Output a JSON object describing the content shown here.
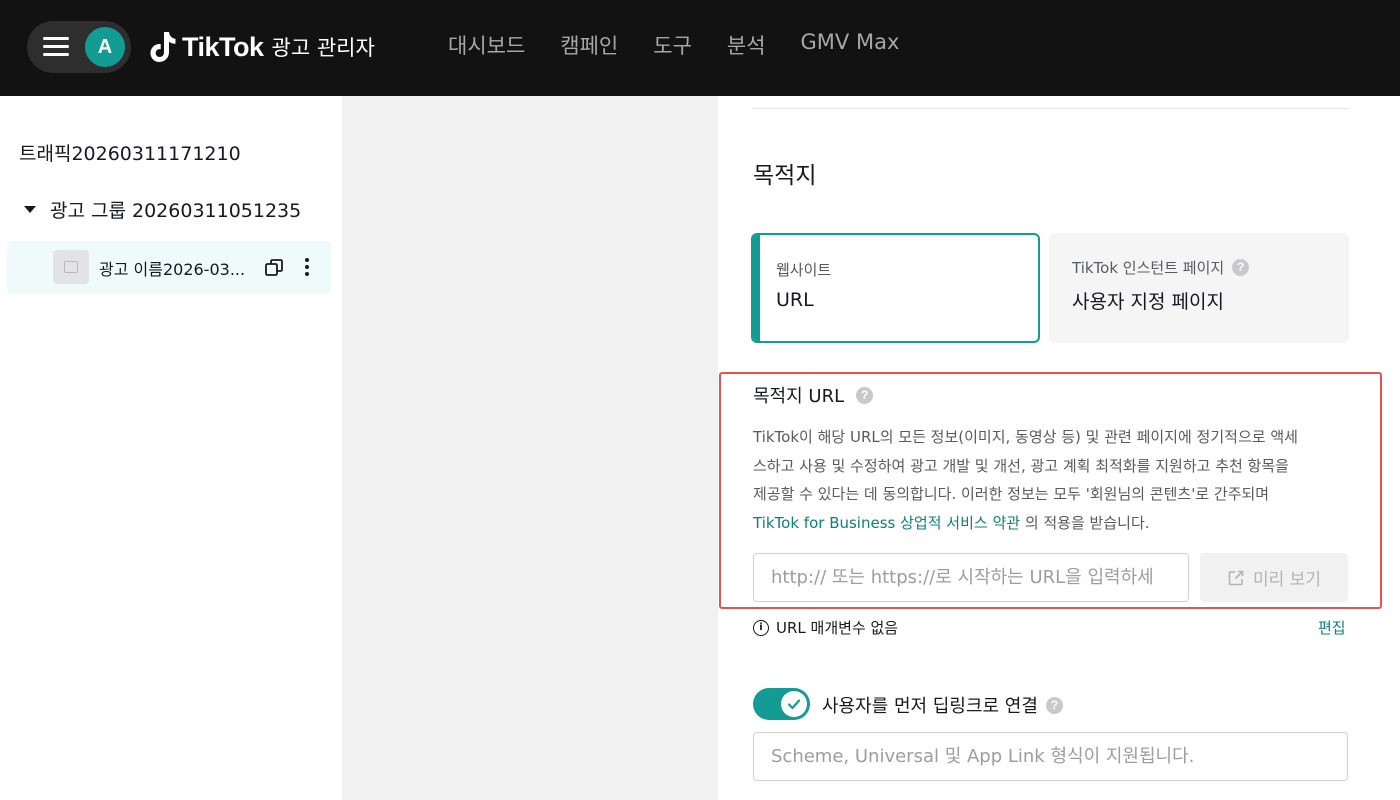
{
  "header": {
    "avatar_letter": "A",
    "brand": "TikTok",
    "brand_sub": "광고 관리자",
    "nav": [
      "대시보드",
      "캠페인",
      "도구",
      "분석",
      "GMV Max"
    ]
  },
  "sidebar": {
    "campaign_name": "트래픽20260311171210",
    "ad_group_name": "광고 그룹 20260311051235",
    "ad_name": "광고 이름2026-03..."
  },
  "destination": {
    "title": "목적지",
    "cards": [
      {
        "label": "웹사이트",
        "value": "URL",
        "selected": true
      },
      {
        "label": "TikTok 인스턴트 페이지",
        "value": "사용자 지정 페이지",
        "selected": false
      }
    ],
    "url_title": "목적지 URL",
    "description_lines": [
      "TikTok이 해당 URL의 모든 정보(이미지, 동영상 등) 및 관련 페이지에 정기적으로 액세",
      "스하고 사용 및 수정하여 광고 개발 및 개선, 광고 계획 최적화를 지원하고 추천 항목을",
      "제공할 수 있다는 데 동의합니다. 이러한 정보는 모두 '회원님의 콘텐츠'로 간주되며"
    ],
    "terms_link": "TikTok for Business 상업적 서비스 약관",
    "terms_suffix": " 의 적용을 받습니다.",
    "url_placeholder": "http:// 또는 https://로 시작하는 URL을 입력하세",
    "preview_label": "미리 보기",
    "params_text": "URL 매개변수 없음",
    "edit_label": "편집",
    "deeplink_label": "사용자를 먼저 딥링크로 연결",
    "deeplink_enabled": true,
    "deeplink_placeholder": "Scheme, Universal 및 App Link 형식이 지원됩니다."
  },
  "colors": {
    "accent": "#139c94",
    "highlight_border": "#e15454",
    "topbar": "#121212"
  }
}
